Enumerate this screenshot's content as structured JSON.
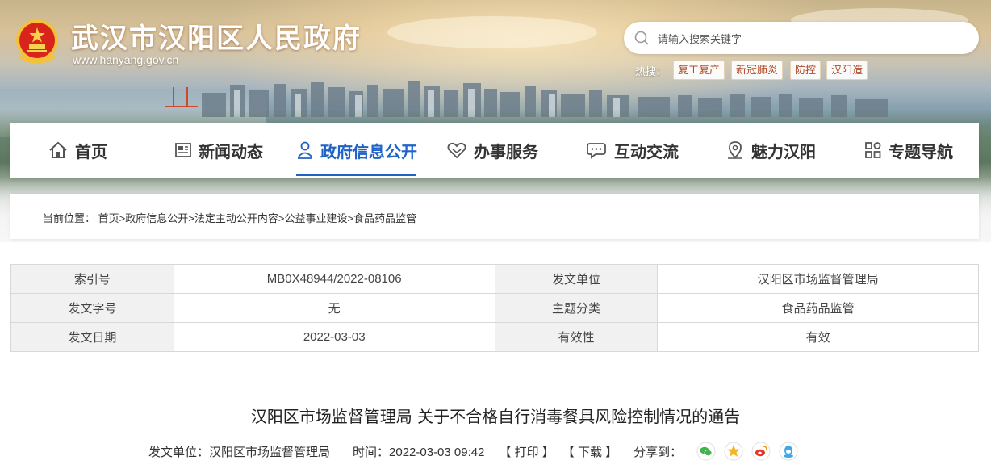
{
  "site": {
    "title": "武汉市汉阳区人民政府",
    "url": "www.hanyang.gov.cn"
  },
  "search": {
    "placeholder": "请输入搜索关键字"
  },
  "hot": {
    "label": "热搜：",
    "tags": [
      "复工复产",
      "新冠肺炎",
      "防控",
      "汉阳造"
    ]
  },
  "nav": {
    "items": [
      {
        "label": "首页",
        "icon": "home-icon"
      },
      {
        "label": "新闻动态",
        "icon": "newspaper-icon"
      },
      {
        "label": "政府信息公开",
        "icon": "person-icon"
      },
      {
        "label": "办事服务",
        "icon": "handshake-icon"
      },
      {
        "label": "互动交流",
        "icon": "chat-icon"
      },
      {
        "label": "魅力汉阳",
        "icon": "location-icon"
      },
      {
        "label": "专题导航",
        "icon": "grid-icon"
      }
    ],
    "active_color": "#1f63c6"
  },
  "breadcrumb": {
    "label": "当前位置：",
    "items": [
      "首页",
      "政府信息公开",
      "法定主动公开内容",
      "公益事业建设",
      "食品药品监管"
    ],
    "separator": ">"
  },
  "info": {
    "rows": [
      [
        "索引号",
        "MB0X48944/2022-08106",
        "发文单位",
        "汉阳区市场监督管理局"
      ],
      [
        "发文字号",
        "无",
        "主题分类",
        "食品药品监管"
      ],
      [
        "发文日期",
        "2022-03-03",
        "有效性",
        "有效"
      ]
    ]
  },
  "article": {
    "title": "汉阳区市场监督管理局 关于不合格自行消毒餐具风险控制情况的通告",
    "source_label": "发文单位：汉阳区市场监督管理局",
    "time_label": "时间：2022-03-03 09:42",
    "print_label": "【 打印 】",
    "download_label": "【 下载 】",
    "share_label": "分享到：",
    "share_icons": [
      "wechat-icon",
      "qzone-icon",
      "weibo-icon",
      "qq-icon"
    ]
  }
}
